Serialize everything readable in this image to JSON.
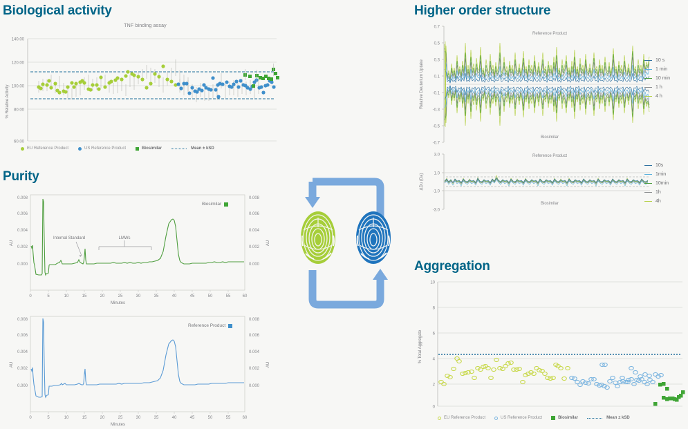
{
  "theme": {
    "background": "#f7f7f5",
    "heading_color": "#006487",
    "eu_green": "#a6ce39",
    "us_blue": "#3f8fcb",
    "biosimilar_green": "#3fa535",
    "mean_line": "#1f6f9c",
    "arrow_blue": "#7aa9dd",
    "axis_gray": "#c9cac6",
    "text_gray": "#7b7c80"
  },
  "sections": {
    "biological_activity": {
      "title": "Biological activity",
      "chart_title": "TNF binding assay",
      "legend": [
        {
          "label": "EU Reference Product",
          "marker": "dot",
          "color": "#a6ce39"
        },
        {
          "label": "US Reference Product",
          "marker": "dot",
          "color": "#3f8fcb"
        },
        {
          "label": "Biosimilar",
          "marker": "square",
          "color": "#3fa535"
        },
        {
          "label": "Mean ± kSD",
          "marker": "dotted-line",
          "color": "#1f6f9c"
        }
      ]
    },
    "purity": {
      "title": "Purity",
      "chart_top_legend": {
        "label": "Biosimilar",
        "marker": "square",
        "color": "#3fa535"
      },
      "chart_bottom_legend": {
        "label": "Reference Product",
        "marker": "square",
        "color": "#3f8fcb"
      },
      "annotations": [
        "Internal Standard",
        "LMWs"
      ]
    },
    "higher_order_structure": {
      "title": "Higher order structure",
      "top_chart": {
        "top_label": "Reference Product",
        "bottom_label": "Biosimilar",
        "legend": [
          "10 s",
          "1 min",
          "10 min",
          "1 h",
          "4 h"
        ]
      },
      "bottom_chart": {
        "top_label": "Reference Product",
        "bottom_label": "Biosimilar",
        "legend": [
          "10s",
          "1min",
          "10min",
          "1h",
          "4h"
        ]
      }
    },
    "aggregation": {
      "title": "Aggregation",
      "legend": [
        {
          "label": "EU Reference Product",
          "marker": "ring",
          "color": "#a6ce39"
        },
        {
          "label": "US Reference Product",
          "marker": "ring",
          "color": "#3f8fcb"
        },
        {
          "label": "Biosimilar",
          "marker": "square",
          "color": "#3fa535"
        },
        {
          "label": "Mean ± kSD",
          "marker": "dotted-line",
          "color": "#1f6f9c"
        }
      ]
    },
    "center_graphic": {
      "name": "fingerprint-comparison-graphic",
      "left_fingerprint_color": "#a6ce39",
      "right_fingerprint_color": "#1f74bd",
      "arrow_color": "#7aa9dd"
    }
  },
  "chart_data": [
    {
      "id": "tnf-binding-assay",
      "type": "scatter",
      "title": "TNF binding assay",
      "xlabel": "",
      "ylabel": "% Relative Activity",
      "ylim": [
        60,
        140
      ],
      "yticks": [
        "60.00",
        "80.00",
        "100.00",
        "120.00",
        "140.00"
      ],
      "grid": true,
      "reference_lines": [
        {
          "label": "Mean + kSD",
          "value": 112
        },
        {
          "label": "Mean - kSD",
          "value": 89
        }
      ],
      "series": [
        {
          "name": "EU Reference Product",
          "color": "#a6ce39",
          "marker": "circle",
          "values": [
            99.8,
            113.8,
            98.2,
            102.9,
            106.9,
            98.4,
            102.1,
            103.9,
            95.1,
            94.3,
            96.2,
            96.0,
            99.7,
            103.7,
            99.7,
            101.9,
            103.4,
            104.7,
            102.6,
            98.1,
            97.6,
            101.5,
            101.4,
            96.9,
            100.2,
            107.9,
            99.9,
            102.8,
            103.9,
            104.2,
            106.4,
            108.1,
            111.9,
            108.4,
            107.7,
            104.8,
            99.0,
            102.7,
            110.7,
            108.0,
            116.9,
            104.8,
            103.2,
            100.3
          ]
        },
        {
          "name": "US Reference Product",
          "color": "#3f8fcb",
          "marker": "circle",
          "values": [
            102.1,
            98.9,
            102.8,
            103.0,
            94.6,
            100.4,
            96.7,
            96.3,
            98.4,
            97.3,
            101.9,
            99.1,
            98.4,
            97.8,
            108.0,
            97.9,
            101.9,
            103.0,
            102.6,
            92.7,
            103.9,
            100.6,
            99.7,
            102.1,
            104.6,
            100.0,
            104.8,
            101.3,
            101.0,
            98.9,
            98.2,
            99.4,
            104.0,
            104.9,
            99.1,
            99.3,
            94.8,
            100.8,
            101.3,
            103.9,
            103.1,
            100.1,
            99.9
          ]
        },
        {
          "name": "Biosimilar",
          "color": "#3fa535",
          "marker": "square",
          "values": [
            107.9,
            106.8,
            98.9,
            107.0,
            105.2,
            104.6,
            106.4,
            104.2,
            104.0,
            113.5,
            110.0,
            105.8
          ]
        }
      ]
    },
    {
      "id": "purity-biosimilar",
      "type": "line",
      "title": "",
      "legend_label": "Biosimilar",
      "color": "#4f9e3f",
      "xlabel": "Minutes",
      "ylabel": "AU",
      "xlim": [
        0,
        60
      ],
      "xticks": [
        0,
        5,
        10,
        15,
        20,
        25,
        30,
        35,
        40,
        45,
        50,
        55,
        60
      ],
      "ylim": [
        -0.0012,
        0.0085
      ],
      "yticks": [
        "0.000",
        "0.002",
        "0.004",
        "0.006",
        "0.008"
      ],
      "right_yticks": [
        "0.000",
        "0.002",
        "0.004",
        "0.006",
        "0.008"
      ],
      "annotations": [
        {
          "text": "Internal Standard",
          "x": 13.0,
          "y": 0.0017
        },
        {
          "text": "LMWs",
          "x": 28.0,
          "y": 0.0017
        }
      ],
      "peaks": [
        {
          "x": 0.2,
          "y": 0.0022
        },
        {
          "x": 3.5,
          "y": 0.0074
        },
        {
          "x": 8.5,
          "y": 0.00045
        },
        {
          "x": 13.3,
          "y": 0.00055
        },
        {
          "x": 16.1,
          "y": 0.0019
        },
        {
          "x": 40.0,
          "y": 0.0053
        }
      ]
    },
    {
      "id": "purity-reference-product",
      "type": "line",
      "title": "",
      "legend_label": "Reference Product",
      "color": "#5b9bd5",
      "xlabel": "Minutes",
      "ylabel": "AU",
      "xlim": [
        0,
        60
      ],
      "xticks": [
        0,
        5,
        10,
        15,
        20,
        25,
        30,
        35,
        40,
        45,
        50,
        55,
        60
      ],
      "ylim": [
        -0.0012,
        0.0085
      ],
      "yticks": [
        "0.000",
        "0.002",
        "0.004",
        "0.006",
        "0.008"
      ],
      "right_yticks": [
        "0.000",
        "0.002",
        "0.004",
        "0.006",
        "0.008"
      ],
      "peaks": [
        {
          "x": 0.2,
          "y": 0.0021
        },
        {
          "x": 3.5,
          "y": 0.0081
        },
        {
          "x": 8.8,
          "y": 0.0005
        },
        {
          "x": 13.5,
          "y": 0.0004
        },
        {
          "x": 16.1,
          "y": 0.0017
        },
        {
          "x": 40.1,
          "y": 0.0054
        }
      ]
    },
    {
      "id": "hdx-relative-deuterium-uptake",
      "type": "line",
      "title": "",
      "top_label": "Reference Product",
      "bottom_label": "Biosimilar",
      "ylabel": "Relative Deuterium Uptake",
      "xlabel": "",
      "ylim": [
        -0.7,
        0.7
      ],
      "yticks": [
        "0.7",
        "0.5",
        "0.3",
        "0.1",
        "-0.1",
        "-0.3",
        "-0.5",
        "-0.7"
      ],
      "series": [
        {
          "name": "10 s",
          "color": "#2f6f9f"
        },
        {
          "name": "1 min",
          "color": "#59b0dd"
        },
        {
          "name": "10 min",
          "color": "#4f9e3f"
        },
        {
          "name": "1 h",
          "color": "#8b8d8f"
        },
        {
          "name": "4 h",
          "color": "#b5d046"
        }
      ]
    },
    {
      "id": "hdx-delta-du",
      "type": "line",
      "title": "",
      "top_label": "Reference Product",
      "bottom_label": "Biosimilar",
      "ylabel": "ΔDu (Da)",
      "xlabel": "",
      "ylim": [
        -3.0,
        3.0
      ],
      "yticks": [
        "3.0",
        "1.0",
        "-1.0",
        "-3.0"
      ],
      "series": [
        {
          "name": "10s",
          "color": "#2f6f9f"
        },
        {
          "name": "1min",
          "color": "#59b0dd"
        },
        {
          "name": "10min",
          "color": "#4f9e3f"
        },
        {
          "name": "1h",
          "color": "#8b8d8f"
        },
        {
          "name": "4h",
          "color": "#b5d046"
        }
      ]
    },
    {
      "id": "aggregation-total-aggregate",
      "type": "scatter",
      "title": "",
      "xlabel": "",
      "ylabel": "% Total Aggregate",
      "ylim": [
        0,
        10
      ],
      "yticks": [
        "0",
        "2",
        "4",
        "6",
        "8",
        "10"
      ],
      "grid": true,
      "reference_lines": [
        {
          "label": "Mean + kSD",
          "value": 4.45
        }
      ],
      "series": [
        {
          "name": "EU Reference Product",
          "color": "#c9d94f",
          "marker": "open-circle",
          "values": [
            2.45,
            2.35,
            2.85,
            2.75,
            3.4,
            4.25,
            4.05,
            2.95,
            3.0,
            3.05,
            3.1,
            2.7,
            3.45,
            3.3,
            3.5,
            3.55,
            3.35,
            2.7,
            3.3,
            4.05,
            3.4,
            3.35,
            3.55,
            3.8,
            3.85,
            3.3,
            3.3,
            3.35,
            2.45,
            2.9,
            3.0,
            3.05,
            2.95,
            3.4,
            3.25,
            3.2,
            2.95,
            2.7,
            2.65,
            2.7,
            3.7,
            3.6,
            3.45,
            2.65,
            3.45
          ]
        },
        {
          "name": "US Reference Product",
          "color": "#7db6e0",
          "marker": "open-circle",
          "values": [
            2.7,
            2.65,
            2.4,
            2.2,
            2.45,
            2.35,
            2.3,
            2.6,
            2.6,
            2.25,
            2.15,
            2.2,
            2.1,
            2.0,
            2.45,
            2.65,
            2.3,
            2.1,
            2.35,
            2.4,
            2.35,
            2.5,
            2.55,
            2.25,
            2.5,
            2.45,
            3.3,
            3.25,
            2.6,
            2.4,
            2.25,
            2.55,
            2.7,
            2.4,
            3.05,
            2.8,
            2.55,
            2.75,
            2.65,
            2.35,
            2.75,
            2.6,
            2.7
          ]
        },
        {
          "name": "Biosimilar",
          "color": "#3fa535",
          "marker": "square",
          "values": [
            0.7,
            2.1,
            2.15,
            1.75,
            1.1,
            1.0,
            1.05,
            1.05,
            1.0,
            0.95,
            1.15,
            1.25,
            1.5
          ]
        }
      ]
    }
  ]
}
